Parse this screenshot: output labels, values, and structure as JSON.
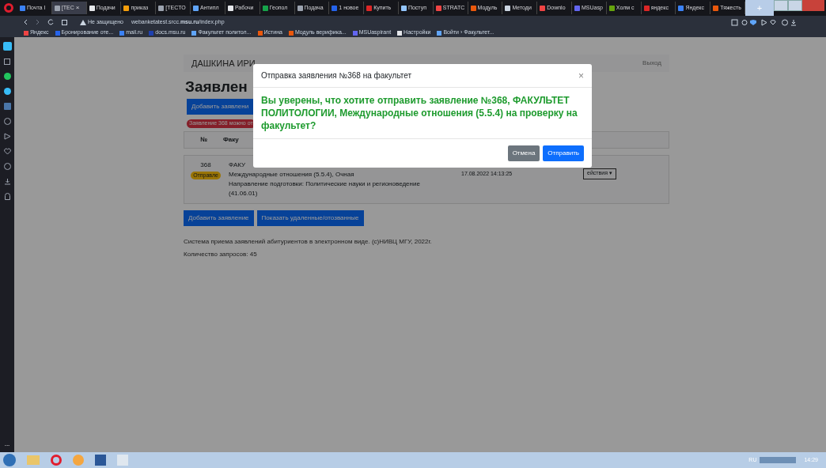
{
  "browser": {
    "tabs": [
      {
        "label": "Почта I",
        "color": "#3b82f6",
        "selected": false
      },
      {
        "label": "[TEC",
        "color": "#9ca3af",
        "selected": true,
        "close": "×"
      },
      {
        "label": "Подачи",
        "color": "#e5e7eb",
        "selected": false
      },
      {
        "label": "приказ",
        "color": "#f59e0b",
        "selected": false
      },
      {
        "label": "[TECTO",
        "color": "#9ca3af",
        "selected": false
      },
      {
        "label": "Антипл",
        "color": "#60a5fa",
        "selected": false
      },
      {
        "label": "Рабочи",
        "color": "#e5e7eb",
        "selected": false
      },
      {
        "label": "Геопол",
        "color": "#16a34a",
        "selected": false
      },
      {
        "label": "Подача",
        "color": "#9ca3af",
        "selected": false
      },
      {
        "label": "1 новое",
        "color": "#2563eb",
        "selected": false
      },
      {
        "label": "Купить",
        "color": "#dc2626",
        "selected": false
      },
      {
        "label": "Поступ",
        "color": "#93c5fd",
        "selected": false
      },
      {
        "label": "STRATC",
        "color": "#ef4444",
        "selected": false
      },
      {
        "label": "Модуль",
        "color": "#ea580c",
        "selected": false
      },
      {
        "label": "Методи",
        "color": "#cbd5e1",
        "selected": false
      },
      {
        "label": "Downlo",
        "color": "#ef4444",
        "selected": false
      },
      {
        "label": "MSUasp",
        "color": "#6366f1",
        "selected": false
      },
      {
        "label": "Холм с",
        "color": "#65a30d",
        "selected": false
      },
      {
        "label": "яндекс",
        "color": "#dc2626",
        "selected": false
      },
      {
        "label": "Яндекс",
        "color": "#3b82f6",
        "selected": false
      },
      {
        "label": "Тяжесть",
        "color": "#ea580c",
        "selected": false
      }
    ],
    "new_tab": "+",
    "security": "Не защищено",
    "url": "webanketatest.srcc.**msu.ru**/index.php",
    "bookmarks": [
      {
        "label": "Яндекс",
        "color": "#ef4444"
      },
      {
        "label": "Бронирование оте...",
        "color": "#2563eb"
      },
      {
        "label": "mail.ru",
        "color": "#3b82f6"
      },
      {
        "label": "docs.msu.ru",
        "color": "#1e40af"
      },
      {
        "label": "Факультет политол...",
        "color": "#60a5fa"
      },
      {
        "label": "Истина",
        "color": "#ea580c"
      },
      {
        "label": "Модуль верифика...",
        "color": "#ea580c"
      },
      {
        "label": "MSUaspirant",
        "color": "#6366f1"
      },
      {
        "label": "Настройки",
        "color": "#e5e7eb"
      },
      {
        "label": "Войти › Факультет...",
        "color": "#60a5fa"
      }
    ]
  },
  "page": {
    "user": "ДАШКИНА ИРИ",
    "logout": "Выход",
    "title": "Заявлен",
    "add_top": "Добавить заявлени",
    "alert": "Заявление 368 можно от",
    "table": {
      "columns": [
        "№",
        "Факу"
      ],
      "row": {
        "number": "368",
        "status": "Отправле",
        "faculty": "ФАКУ",
        "program": "Международные отношения (5.5.4), Очная",
        "direction": "Направление подготовки: Политические науки и регионоведение (41.06.01)",
        "date": "17.08.2022 14:13:25",
        "actions": "ействия ▾"
      }
    },
    "buttons": [
      "Добавить заявление",
      "Показать удаленные/отозванные"
    ],
    "footer": "Система приема заявлений абитуриентов в электронном виде. (c)НИВЦ МГУ, 2022г.",
    "requests": "Количество запросов: 45"
  },
  "modal": {
    "title": "Отправка заявления №368 на факультет",
    "close": "×",
    "message": "Вы уверены, что хотите отправить заявление №368, ФАКУЛЬТЕТ ПОЛИТОЛОГИИ, Международные отношения (5.5.4) на проверку на факультет?",
    "cancel": "Отмена",
    "submit": "Отправить"
  },
  "sidebar_more": "...",
  "taskbar": {
    "language": "RU",
    "clock": "14:29"
  }
}
